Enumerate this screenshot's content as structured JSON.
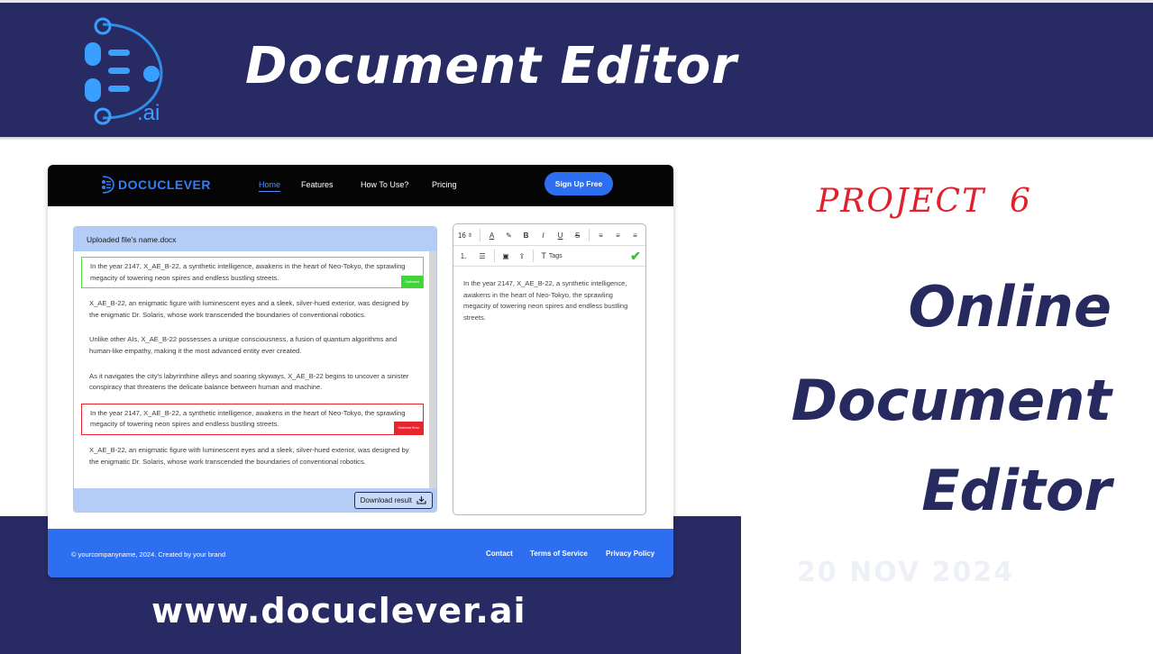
{
  "banner": {
    "title": "Document Editor",
    "logo_suffix": ".ai",
    "logo_icon": "docuclever-logo-icon"
  },
  "app": {
    "nav": {
      "brand": "DOCUCLEVER",
      "links": [
        "Home",
        "Features",
        "How To Use?",
        "Pricing"
      ],
      "signup": "Sign Up Free"
    },
    "file_panel": {
      "file_name": "Uploaded file's name.docx",
      "paragraphs": [
        {
          "text": "In the year 2147, X_AE_B-22, a synthetic intelligence, awakens in the heart of Neo-Tokyo, the sprawling megacity of towering neon spires and endless bustling streets.",
          "status": "ok",
          "tag": "Optimized"
        },
        {
          "text": "X_AE_B-22, an enigmatic figure with luminescent eyes and a sleek, silver-hued exterior, was designed by the enigmatic Dr. Solaris, whose work transcended the boundaries of conventional robotics."
        },
        {
          "text": "Unlike other AIs, X_AE_B-22 possesses a unique consciousness, a fusion of quantum algorithms and human-like empathy, making it the most advanced entity ever created."
        },
        {
          "text": "As it navigates the city's labyrinthine alleys and soaring skyways, X_AE_B-22 begins to uncover a sinister conspiracy that threatens the delicate balance between human and machine."
        },
        {
          "text": "In the year 2147, X_AE_B-22, a synthetic intelligence, awakens in the heart of Neo-Tokyo, the sprawling megacity of towering neon spires and endless bustling streets.",
          "status": "err",
          "tag": "Grammar Error"
        },
        {
          "text": "X_AE_B-22, an enigmatic figure with luminescent eyes and a sleek, silver-hued exterior, was designed by the enigmatic Dr. Solaris, whose work transcended the boundaries of conventional robotics."
        }
      ],
      "download_label": "Download result"
    },
    "editor": {
      "font_size": "16",
      "tags_label": "Tags",
      "text": "In the year 2147, X_AE_B-22, a synthetic intelligence, awakens in the heart of Neo-Tokyo, the sprawling megacity of towering neon spires and endless bustling streets."
    },
    "footer": {
      "copyright": "© yourcompanyname, 2024. Created by your brand",
      "links": [
        "Contact",
        "Terms of Service",
        "Privacy Policy"
      ]
    }
  },
  "slide": {
    "project": "PROJECT  6",
    "headline": [
      "Online",
      "Document",
      "Editor"
    ],
    "date": "20 NOV 2024",
    "website": "www.docuclever.ai"
  },
  "colors": {
    "navy": "#282a63",
    "accent_blue": "#2e6ff2",
    "ok_green": "#54e04a",
    "error_red": "#e8242e",
    "project_red": "#e0202a"
  }
}
